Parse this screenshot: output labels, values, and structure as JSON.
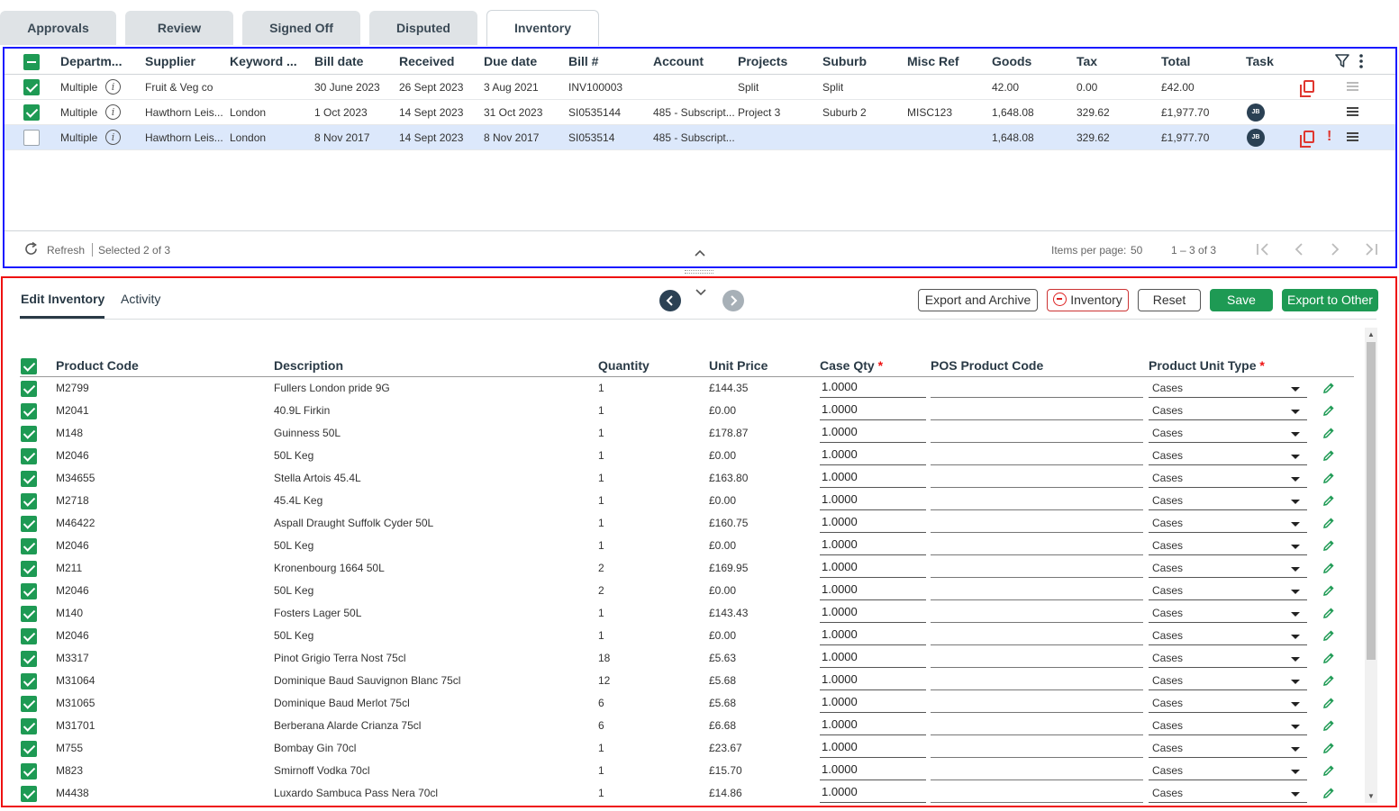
{
  "tabs": [
    {
      "label": "Approvals"
    },
    {
      "label": "Review"
    },
    {
      "label": "Signed Off"
    },
    {
      "label": "Disputed"
    },
    {
      "label": "Inventory"
    }
  ],
  "bills": {
    "columns": [
      "Departm...",
      "Supplier",
      "Keyword ...",
      "Bill date",
      "Received",
      "Due date",
      "Bill #",
      "Account",
      "Projects",
      "Suburb",
      "Misc Ref",
      "Goods",
      "Tax",
      "Total",
      "Task"
    ],
    "rows": [
      {
        "checked": true,
        "dept": "Multiple",
        "supplier": "Fruit & Veg co",
        "keyword": "",
        "bill_date": "30 June 2023",
        "received": "26 Sept 2023",
        "due_date": "3 Aug 2021",
        "bill_no": "INV100003",
        "account": "",
        "projects": "Split",
        "suburb": "Split",
        "misc_ref": "",
        "goods": "42.00",
        "tax": "0.00",
        "total": "£42.00",
        "task": "",
        "avatar": "",
        "alert": false
      },
      {
        "checked": true,
        "dept": "Multiple",
        "supplier": "Hawthorn Leis...",
        "keyword": "London",
        "bill_date": "1 Oct 2023",
        "received": "14 Sept 2023",
        "due_date": "31 Oct 2023",
        "bill_no": "SI0535144",
        "account": "485 - Subscript...",
        "projects": "Project 3",
        "suburb": "Suburb 2",
        "misc_ref": "MISC123",
        "goods": "1,648.08",
        "tax": "329.62",
        "total": "£1,977.70",
        "avatar": "JB",
        "alert": false
      },
      {
        "checked": false,
        "dept": "Multiple",
        "supplier": "Hawthorn Leis...",
        "keyword": "London",
        "bill_date": "8 Nov 2017",
        "received": "14 Sept 2023",
        "due_date": "8 Nov 2017",
        "bill_no": "SI053514",
        "account": "485 - Subscript...",
        "projects": "",
        "suburb": "",
        "misc_ref": "",
        "goods": "1,648.08",
        "tax": "329.62",
        "total": "£1,977.70",
        "avatar": "JB",
        "alert": true
      }
    ],
    "footer": {
      "refresh_label": "Refresh",
      "selected_text": "Selected 2 of 3",
      "items_per_page_label": "Items per page:",
      "items_per_page": "50",
      "range_text": "1 – 3 of 3"
    }
  },
  "inventory": {
    "subtabs": [
      "Edit Inventory",
      "Activity"
    ],
    "buttons": {
      "export_archive": "Export and Archive",
      "inventory": "Inventory",
      "reset": "Reset",
      "save": "Save",
      "export_other": "Export to Other"
    },
    "columns": {
      "product_code": "Product Code",
      "description": "Description",
      "quantity": "Quantity",
      "unit_price": "Unit Price",
      "case_qty": "Case Qty",
      "pos_code": "POS Product Code",
      "unit_type": "Product Unit Type",
      "required_mark": "*"
    },
    "rows": [
      {
        "code": "M2799",
        "desc": "Fullers London pride 9G",
        "qty": "1",
        "price": "£144.35",
        "case_qty": "1.0000",
        "pos": "",
        "unit": "Cases"
      },
      {
        "code": "M2041",
        "desc": "40.9L Firkin",
        "qty": "1",
        "price": "£0.00",
        "case_qty": "1.0000",
        "pos": "",
        "unit": "Cases"
      },
      {
        "code": "M148",
        "desc": "Guinness 50L",
        "qty": "1",
        "price": "£178.87",
        "case_qty": "1.0000",
        "pos": "",
        "unit": "Cases"
      },
      {
        "code": "M2046",
        "desc": "50L Keg",
        "qty": "1",
        "price": "£0.00",
        "case_qty": "1.0000",
        "pos": "",
        "unit": "Cases"
      },
      {
        "code": "M34655",
        "desc": "Stella Artois 45.4L",
        "qty": "1",
        "price": "£163.80",
        "case_qty": "1.0000",
        "pos": "",
        "unit": "Cases"
      },
      {
        "code": "M2718",
        "desc": "45.4L Keg",
        "qty": "1",
        "price": "£0.00",
        "case_qty": "1.0000",
        "pos": "",
        "unit": "Cases"
      },
      {
        "code": "M46422",
        "desc": "Aspall Draught Suffolk Cyder 50L",
        "qty": "1",
        "price": "£160.75",
        "case_qty": "1.0000",
        "pos": "",
        "unit": "Cases"
      },
      {
        "code": "M2046",
        "desc": "50L Keg",
        "qty": "1",
        "price": "£0.00",
        "case_qty": "1.0000",
        "pos": "",
        "unit": "Cases"
      },
      {
        "code": "M211",
        "desc": "Kronenbourg 1664 50L",
        "qty": "2",
        "price": "£169.95",
        "case_qty": "1.0000",
        "pos": "",
        "unit": "Cases"
      },
      {
        "code": "M2046",
        "desc": "50L Keg",
        "qty": "2",
        "price": "£0.00",
        "case_qty": "1.0000",
        "pos": "",
        "unit": "Cases"
      },
      {
        "code": "M140",
        "desc": "Fosters Lager 50L",
        "qty": "1",
        "price": "£143.43",
        "case_qty": "1.0000",
        "pos": "",
        "unit": "Cases"
      },
      {
        "code": "M2046",
        "desc": "50L Keg",
        "qty": "1",
        "price": "£0.00",
        "case_qty": "1.0000",
        "pos": "",
        "unit": "Cases"
      },
      {
        "code": "M3317",
        "desc": "Pinot Grigio Terra Nost 75cl",
        "qty": "18",
        "price": "£5.63",
        "case_qty": "1.0000",
        "pos": "",
        "unit": "Cases"
      },
      {
        "code": "M31064",
        "desc": "Dominique Baud Sauvignon Blanc 75cl",
        "qty": "12",
        "price": "£5.68",
        "case_qty": "1.0000",
        "pos": "",
        "unit": "Cases"
      },
      {
        "code": "M31065",
        "desc": "Dominique Baud Merlot 75cl",
        "qty": "6",
        "price": "£5.68",
        "case_qty": "1.0000",
        "pos": "",
        "unit": "Cases"
      },
      {
        "code": "M31701",
        "desc": "Berberana Alarde Crianza 75cl",
        "qty": "6",
        "price": "£6.68",
        "case_qty": "1.0000",
        "pos": "",
        "unit": "Cases"
      },
      {
        "code": "M755",
        "desc": "Bombay Gin 70cl",
        "qty": "1",
        "price": "£23.67",
        "case_qty": "1.0000",
        "pos": "",
        "unit": "Cases"
      },
      {
        "code": "M823",
        "desc": "Smirnoff Vodka 70cl",
        "qty": "1",
        "price": "£15.70",
        "case_qty": "1.0000",
        "pos": "",
        "unit": "Cases"
      },
      {
        "code": "M4438",
        "desc": "Luxardo Sambuca Pass Nera 70cl",
        "qty": "1",
        "price": "£14.86",
        "case_qty": "1.0000",
        "pos": "",
        "unit": "Cases"
      }
    ]
  },
  "colors": {
    "accent_green": "#1e9a54",
    "alert_red": "#e0362f",
    "selected_row": "#dce8fb",
    "bills_border": "#1a1aff",
    "inventory_border": "#e11111"
  }
}
